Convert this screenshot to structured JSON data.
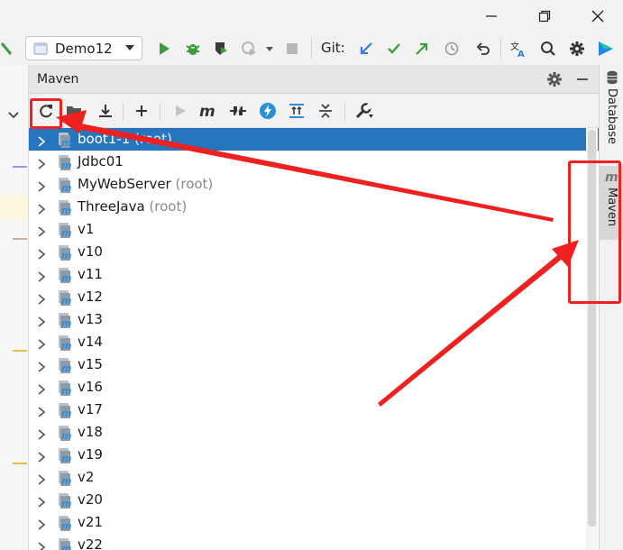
{
  "toolbar": {
    "run_config": "Demo12",
    "git_label": "Git:"
  },
  "maven": {
    "title": "Maven",
    "projects": [
      {
        "name": "boot1-1",
        "suffix": "(root)",
        "selected": true
      },
      {
        "name": "Jdbc01",
        "suffix": ""
      },
      {
        "name": "MyWebServer",
        "suffix": "(root)"
      },
      {
        "name": "ThreeJava",
        "suffix": "(root)"
      },
      {
        "name": "v1",
        "suffix": ""
      },
      {
        "name": "v10",
        "suffix": ""
      },
      {
        "name": "v11",
        "suffix": ""
      },
      {
        "name": "v12",
        "suffix": ""
      },
      {
        "name": "v13",
        "suffix": ""
      },
      {
        "name": "v14",
        "suffix": ""
      },
      {
        "name": "v15",
        "suffix": ""
      },
      {
        "name": "v16",
        "suffix": ""
      },
      {
        "name": "v17",
        "suffix": ""
      },
      {
        "name": "v18",
        "suffix": ""
      },
      {
        "name": "v19",
        "suffix": ""
      },
      {
        "name": "v2",
        "suffix": ""
      },
      {
        "name": "v20",
        "suffix": ""
      },
      {
        "name": "v21",
        "suffix": ""
      },
      {
        "name": "v22",
        "suffix": ""
      }
    ]
  },
  "side_tabs": {
    "database": "Database",
    "maven": "Maven"
  },
  "colors": {
    "accent": "#2675bf",
    "annotation": "#ee2020",
    "run_green": "#3c9e3c",
    "git_blue": "#2f7fd6"
  }
}
